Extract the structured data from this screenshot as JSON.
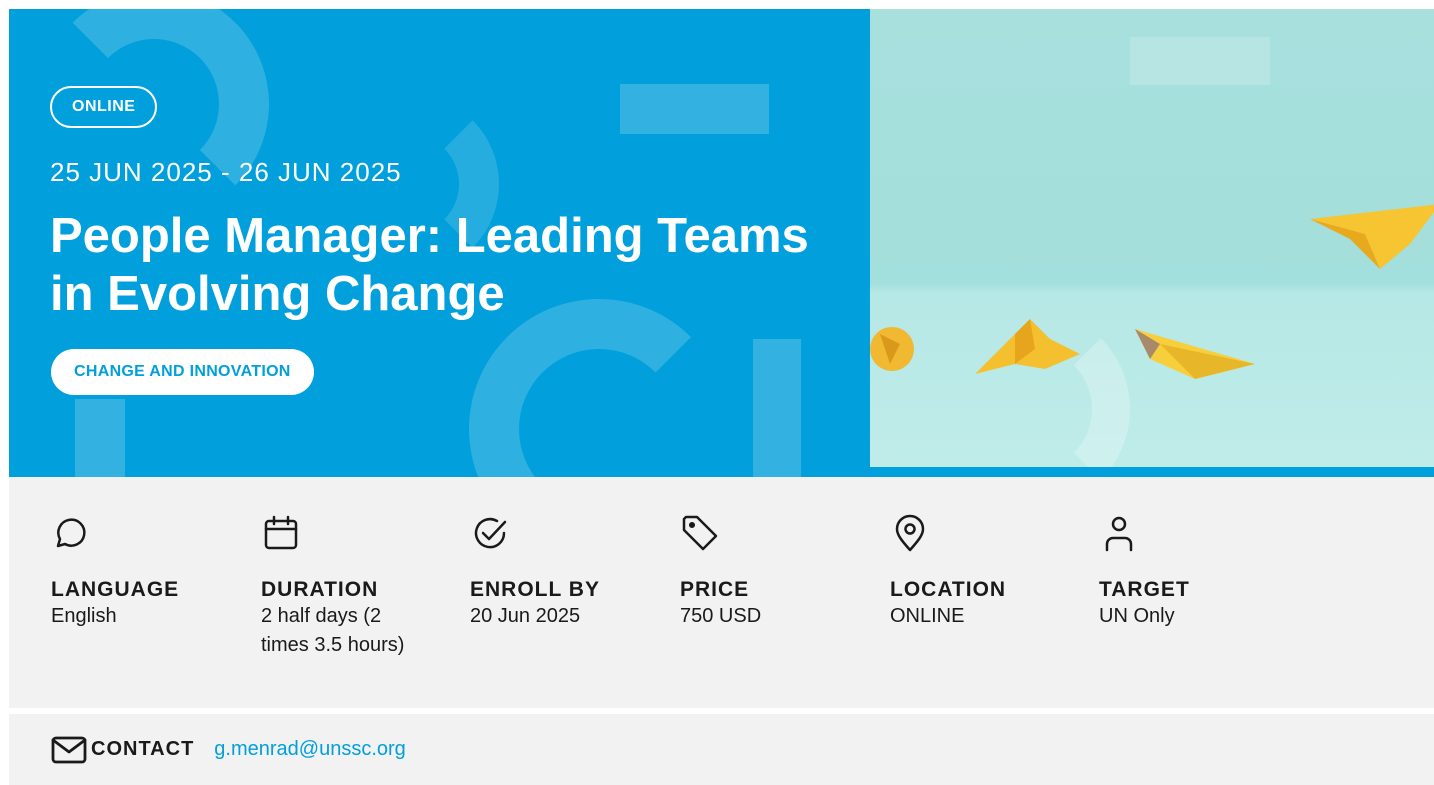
{
  "hero": {
    "mode_badge": "ONLINE",
    "dates": "25 JUN 2025 - 26 JUN 2025",
    "title": "People Manager: Leading Teams in Evolving Change",
    "topic_badge": "CHANGE AND INNOVATION",
    "image_icon": "paper-planes-image"
  },
  "colors": {
    "brand_blue": "#019fdb",
    "panel_gray": "#f2f2f2",
    "text_dark": "#1a1a1a"
  },
  "details": [
    {
      "icon": "chat-bubble-icon",
      "label": "LANGUAGE",
      "value": "English"
    },
    {
      "icon": "calendar-icon",
      "label": "DURATION",
      "value": "2 half days (2 times 3.5 hours)"
    },
    {
      "icon": "check-circle-icon",
      "label": "ENROLL BY",
      "value": "20 Jun 2025"
    },
    {
      "icon": "price-tag-icon",
      "label": "PRICE",
      "value": "750 USD"
    },
    {
      "icon": "location-pin-icon",
      "label": "LOCATION",
      "value": "ONLINE"
    },
    {
      "icon": "person-icon",
      "label": "TARGET",
      "value": "UN Only"
    }
  ],
  "contact": {
    "icon": "envelope-icon",
    "label": "CONTACT",
    "email": "g.menrad@unssc.org"
  }
}
